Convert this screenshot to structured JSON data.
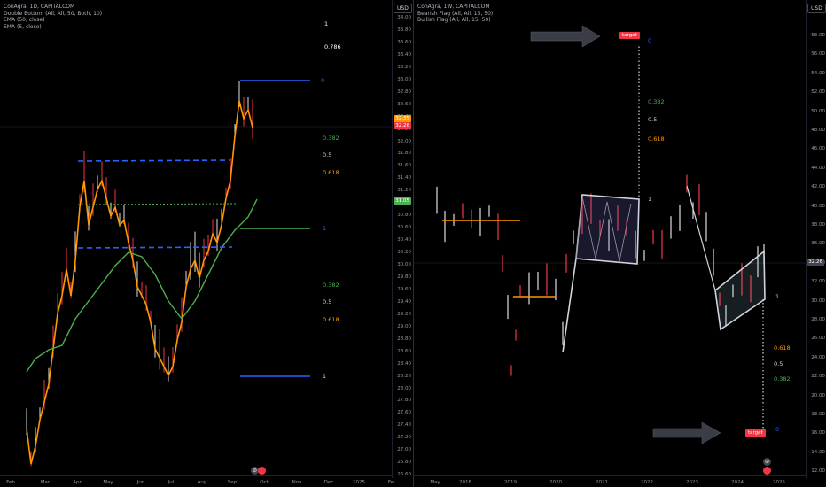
{
  "left": {
    "legend": [
      "ConAgra, 1D, CAPITALCOM",
      "Double Bottom (All, All, 50, Both, 10)",
      "EMA (50, close)",
      "EMA (5, close)"
    ],
    "currency": "USD",
    "price_ticks": [
      "34.00",
      "33.80",
      "33.60",
      "33.40",
      "33.20",
      "33.00",
      "32.80",
      "32.60",
      "32.40",
      "32.20",
      "32.00",
      "31.80",
      "31.60",
      "31.40",
      "31.20",
      "31.00",
      "30.80",
      "30.60",
      "30.40",
      "30.20",
      "30.00",
      "29.80",
      "29.60",
      "29.40",
      "29.20",
      "29.00",
      "28.80",
      "28.60",
      "28.40",
      "28.20",
      "28.00",
      "27.80",
      "27.60",
      "27.40",
      "27.20",
      "27.00",
      "26.80",
      "26.60"
    ],
    "time_ticks": [
      "Feb",
      "Mar",
      "Apr",
      "May",
      "Jun",
      "Jul",
      "Aug",
      "Sep",
      "Oct",
      "Nov",
      "Dec",
      "2025",
      "Fe"
    ],
    "fib_labels": {
      "one": "1",
      "r0786": "0.786",
      "zero": "0",
      "r0382a": "0.382",
      "r05a": "0.5",
      "r0618a": "0.618",
      "one_b": "1",
      "r0382b": "0.382",
      "r05b": "0.5",
      "r0618b": "0.618",
      "one_c": "1"
    },
    "price_badges": {
      "last_a": "32.35",
      "last_b": "32.26",
      "ema": "31.05"
    },
    "icon_glyph": "⊘"
  },
  "right": {
    "legend": [
      "ConAgra, 1W, CAPITALCOM",
      "Bearish Flag (All, All, 15, 50)",
      "Bullish Flag (All, All, 15, 50)"
    ],
    "currency": "USD",
    "price_ticks": [
      "58.00",
      "56.00",
      "54.00",
      "52.00",
      "50.00",
      "48.00",
      "46.00",
      "44.00",
      "42.00",
      "40.00",
      "38.00",
      "36.00",
      "34.00",
      "32.00",
      "30.00",
      "28.00",
      "26.00",
      "24.00",
      "22.00",
      "20.00",
      "18.00",
      "16.00",
      "14.00",
      "12.00",
      "10.00"
    ],
    "time_ticks": [
      "May",
      "2018",
      "2019",
      "2020",
      "2021",
      "2022",
      "2023",
      "2024",
      "2025"
    ],
    "target_label": "target",
    "fib_labels": {
      "top0": "0",
      "top0382": "0.382",
      "top05": "0.5",
      "top0618": "0.618",
      "top1": "1",
      "bot1": "1",
      "bot0618": "0.618",
      "bot05": "0.5",
      "bot0382": "0.382",
      "bot0": "0"
    },
    "price_badge": "32.26",
    "icon_glyph": "⊘"
  },
  "colors": {
    "blue": "#2962ff",
    "green": "#4caf50",
    "orange": "#ff9800",
    "red": "#f23645",
    "white": "#d1d4dc"
  }
}
